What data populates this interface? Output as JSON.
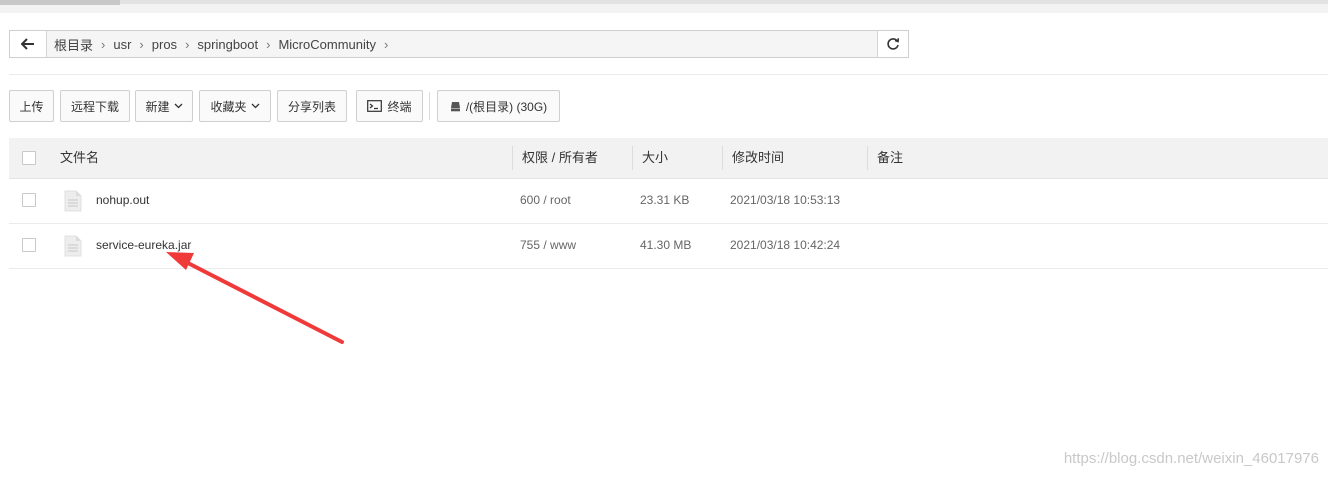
{
  "breadcrumb": {
    "items": [
      "根目录",
      "usr",
      "pros",
      "springboot",
      "MicroCommunity"
    ]
  },
  "toolbar": {
    "upload": "上传",
    "remote_download": "远程下载",
    "new": "新建",
    "favorites": "收藏夹",
    "share_list": "分享列表",
    "terminal": "终端",
    "disk": "/(根目录) (30G)"
  },
  "table": {
    "headers": {
      "name": "文件名",
      "perm": "权限 / 所有者",
      "size": "大小",
      "mtime": "修改时间",
      "note": "备注"
    },
    "rows": [
      {
        "name": "nohup.out",
        "perm": "600 / root",
        "size": "23.31 KB",
        "mtime": "2021/03/18 10:53:13",
        "note": ""
      },
      {
        "name": "service-eureka.jar",
        "perm": "755 / www",
        "size": "41.30 MB",
        "mtime": "2021/03/18 10:42:24",
        "note": ""
      }
    ]
  },
  "watermark": "https://blog.csdn.net/weixin_46017976",
  "colors": {
    "annotation_arrow": "#f03a3a",
    "header_bg": "#f2f2f2"
  }
}
